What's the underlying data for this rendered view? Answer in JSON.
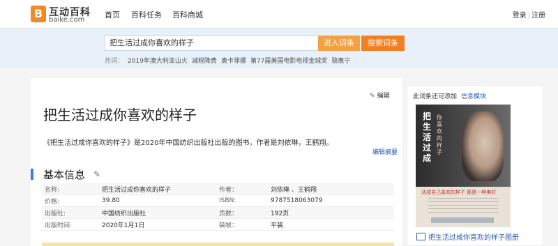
{
  "header": {
    "logo_cn": "互动百科",
    "logo_en": "baike.com",
    "logo_mark": "B",
    "nav": [
      "首页",
      "百科任务",
      "百科商城"
    ],
    "login": "登录",
    "register": "注册"
  },
  "search": {
    "value": "把生活过成你喜欢的样子",
    "enter_label": "进入词条",
    "search_label": "搜索词条",
    "hot_label": "热词：",
    "hot_terms": [
      "2019年澳大利亚山火",
      "减税降费",
      "奥卡菲娜",
      "第77届美国电影电视金球奖",
      "骆惠宁"
    ]
  },
  "entry": {
    "edit_label": "编辑",
    "title": "把生活过成你喜欢的样子",
    "summary": "《把生活过成你喜欢的样子》是2020年中国纺织出版社出版的图书，作者是刘依琳，王鹤翔。",
    "edit_summary": "编辑摘要",
    "section_title": "基本信息",
    "info_rows": [
      {
        "k1": "名称:",
        "v1": "把生活过成你喜欢的样子",
        "k2": "作者：",
        "v2": "刘依琳 、王鹤翔"
      },
      {
        "k1": "价格:",
        "v1": "39.80",
        "k2": "ISBN:",
        "v2": "9787518063079"
      },
      {
        "k1": "出版社:",
        "v1": "中国纺织出版社",
        "k2": "页数：",
        "v2": "192页"
      },
      {
        "k1": "出版时间:",
        "v1": "2020年1月1日",
        "k2": "装帧：",
        "v2": "平装"
      }
    ]
  },
  "side": {
    "head_text": "此词条还可添加",
    "head_link": "信息模块",
    "cover_title": "把生活过成",
    "cover_subtitle": "你喜欢的样子",
    "cover_tagline": "活成自己喜欢的样子 那是一种美好",
    "caption": "把生活过成你喜欢的样子图册"
  },
  "colors": {
    "accent_orange": "#f37f22",
    "link_blue": "#2a5db0",
    "section_bar": "#3b7dd8"
  }
}
